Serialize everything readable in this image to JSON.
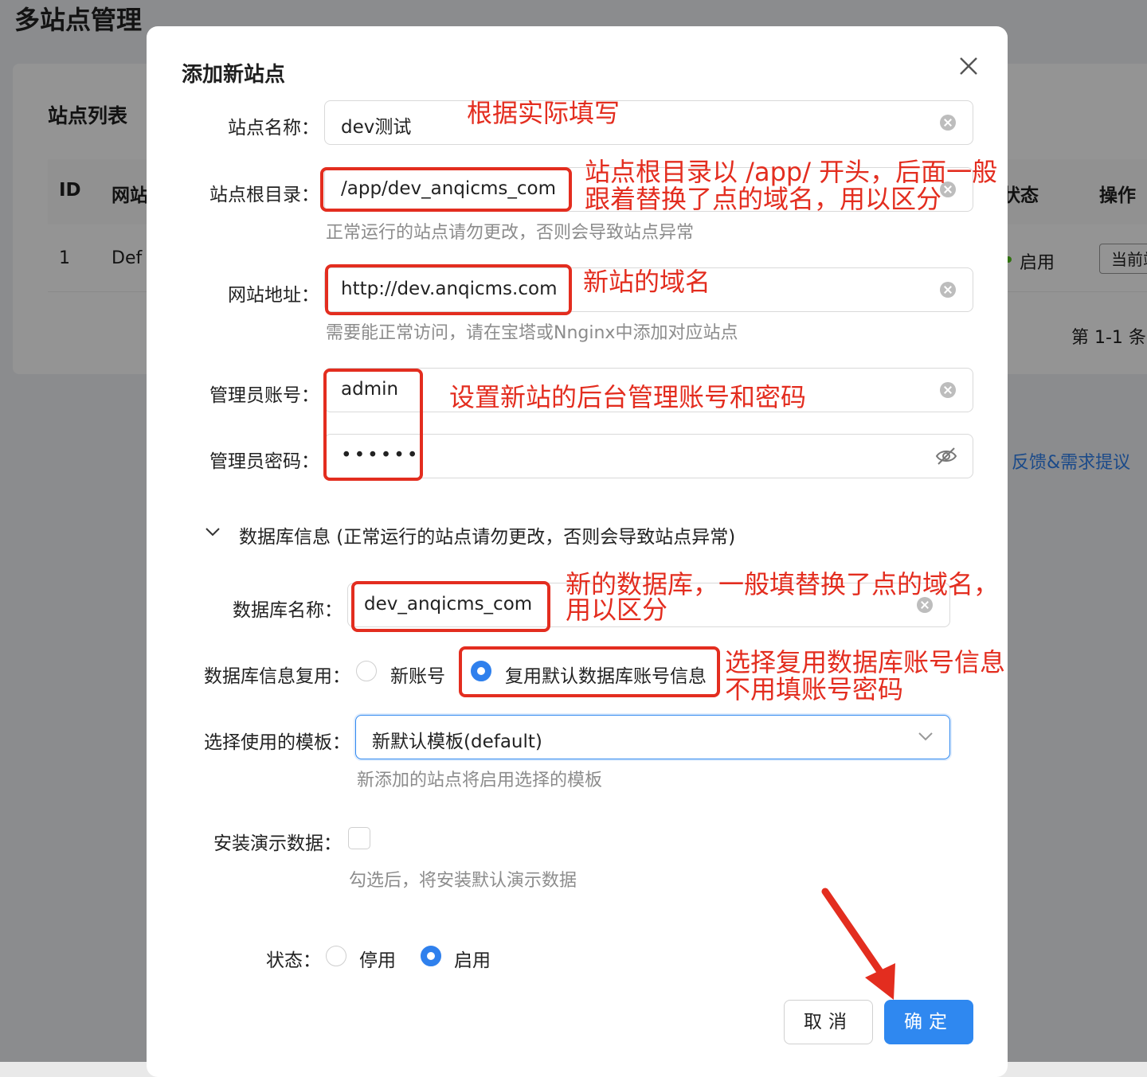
{
  "background": {
    "page_title": "多站点管理",
    "card_title": "站点列表",
    "table_headers": [
      "ID",
      "网站",
      "状态",
      "操作"
    ],
    "row": {
      "id": "1",
      "name": "Def",
      "status": "启用",
      "action": "当前站"
    },
    "pagination": "第 1-1 条",
    "feedback_link": "反馈&需求提议"
  },
  "modal": {
    "title": "添加新站点",
    "fields": {
      "site_name": {
        "label": "站点名称：",
        "value": "dev测试"
      },
      "root_dir": {
        "label": "站点根目录：",
        "value": "/app/dev_anqicms_com",
        "hint": "正常运行的站点请勿更改，否则会导致站点异常"
      },
      "site_url": {
        "label": "网站地址：",
        "value": "http://dev.anqicms.com",
        "hint": "需要能正常访问，请在宝塔或Nnginx中添加对应站点"
      },
      "admin_user": {
        "label": "管理员账号：",
        "value": "admin"
      },
      "admin_pass": {
        "label": "管理员密码：",
        "value": "••••••"
      },
      "db_section": {
        "label": "数据库信息 (正常运行的站点请勿更改，否则会导致站点异常)"
      },
      "db_name": {
        "label": "数据库名称：",
        "value": "dev_anqicms_com"
      },
      "db_reuse": {
        "label": "数据库信息复用：",
        "options": [
          "新账号",
          "复用默认数据库账号信息"
        ],
        "selected": "复用默认数据库账号信息"
      },
      "template": {
        "label": "选择使用的模板：",
        "value": "新默认模板(default)",
        "hint": "新添加的站点将启用选择的模板"
      },
      "demo_data": {
        "label": "安装演示数据：",
        "checked": false,
        "hint": "勾选后，将安装默认演示数据"
      },
      "status": {
        "label": "状态：",
        "options": [
          "停用",
          "启用"
        ],
        "selected": "启用"
      }
    },
    "buttons": {
      "cancel": "取消",
      "ok": "确定"
    }
  },
  "annotations": {
    "site_name": "根据实际填写",
    "root_dir_line1": "站点根目录以 /app/ 开头，后面一般",
    "root_dir_line2": "跟着替换了点的域名，用以区分",
    "site_url": "新站的域名",
    "admin": "设置新站的后台管理账号和密码",
    "db_name_line1": "新的数据库，一般填替换了点的域名，",
    "db_name_line2": "用以区分",
    "db_reuse_line1": "选择复用数据库账号信息",
    "db_reuse_line2": "不用填账号密码"
  },
  "colors": {
    "accent": "#2f88f0",
    "annotation": "#e32d1f"
  }
}
